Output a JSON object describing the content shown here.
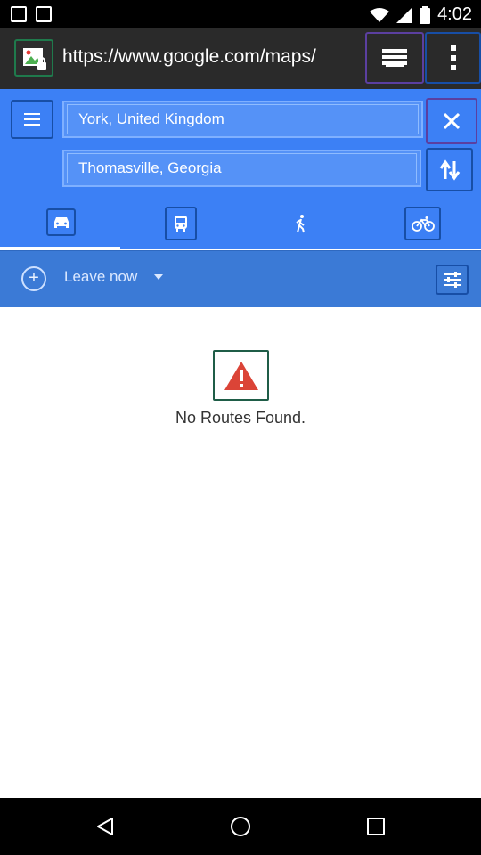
{
  "status_bar": {
    "time": "4:02",
    "icons": [
      "notification-square-icon",
      "notification-square-icon",
      "wifi-icon",
      "signal-icon",
      "battery-icon"
    ]
  },
  "browser": {
    "url": "https://www.google.com/maps/",
    "favicon": "image-lock-icon",
    "toolbar_icons": [
      "tabs-menu-icon",
      "more-vert-icon"
    ]
  },
  "directions": {
    "origin": "York, United Kingdom",
    "destination": "Thomasville, Georgia",
    "modes": [
      {
        "name": "car-icon",
        "selected": true
      },
      {
        "name": "transit-icon",
        "selected": false
      },
      {
        "name": "walk-icon",
        "selected": false
      },
      {
        "name": "bike-icon",
        "selected": false
      }
    ],
    "time_option": "Leave now"
  },
  "result": {
    "message": "No Routes Found.",
    "icon": "warning-icon"
  },
  "colors": {
    "header_blue": "#3c80f5",
    "timebar_blue": "#3b7ad6",
    "field_blue": "#5592f7",
    "warning_red": "#db4437"
  },
  "nav_bar": {
    "icons": [
      "back-icon",
      "home-icon",
      "recents-icon"
    ]
  }
}
